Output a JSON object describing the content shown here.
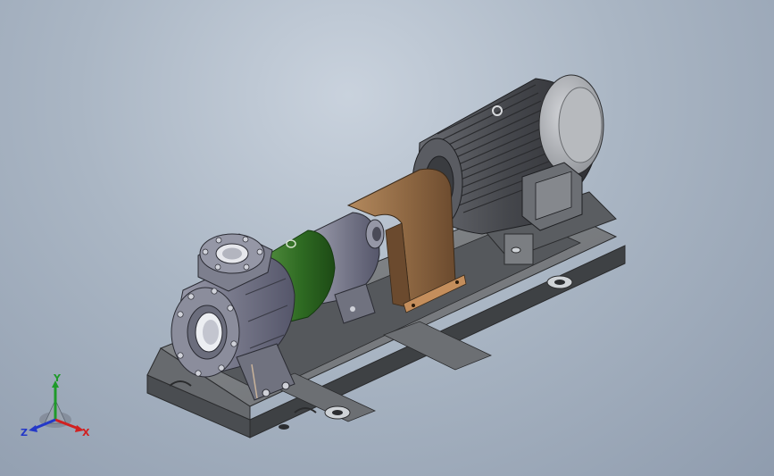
{
  "triad": {
    "x_label": "X",
    "y_label": "Y",
    "z_label": "Z",
    "x_color": "#d12020",
    "y_color": "#1f9a2a",
    "z_color": "#2438c8"
  },
  "colors": {
    "casing": "#6e6f80",
    "base": "#5e6165",
    "green_part": "#2e6a22",
    "coupling_guard": "#8a6440",
    "motor": "#4b4d52"
  }
}
